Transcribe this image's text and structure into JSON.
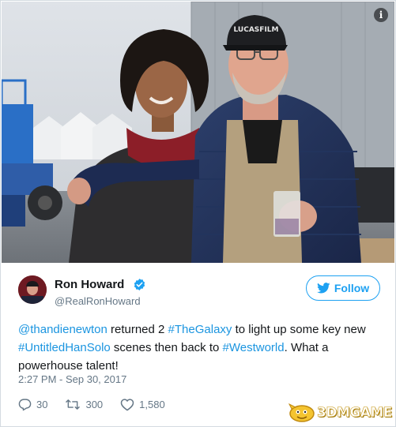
{
  "photo": {
    "alt": "Thandie Newton and Ron Howard on set",
    "cap_text": "LUCASFILM"
  },
  "info_icon": "i",
  "tweet": {
    "author_name": "Ron Howard",
    "handle": "@RealRonHoward",
    "follow_label": "Follow",
    "text": {
      "mention": "@thandienewton",
      "part1": " returned 2 ",
      "hashtag1": "#TheGalaxy",
      "part2": " to light up some key new ",
      "hashtag2": "#UntitledHanSolo",
      "part3": " scenes then back to ",
      "hashtag3": "#Westworld",
      "part4": ". What a powerhouse talent!"
    },
    "timestamp": "2:27 PM - Sep 30, 2017",
    "replies": "30",
    "retweets": "300",
    "likes": "1,580"
  },
  "watermark": "3DMGAME",
  "colors": {
    "link": "#1b95e0",
    "follow": "#1da1f2",
    "verified": "#1da1f2",
    "secondary_text": "#657786"
  },
  "icons": [
    "info-icon",
    "verified-badge-icon",
    "twitter-bird-icon",
    "reply-icon",
    "retweet-icon",
    "like-icon",
    "watermark-logo-icon"
  ]
}
